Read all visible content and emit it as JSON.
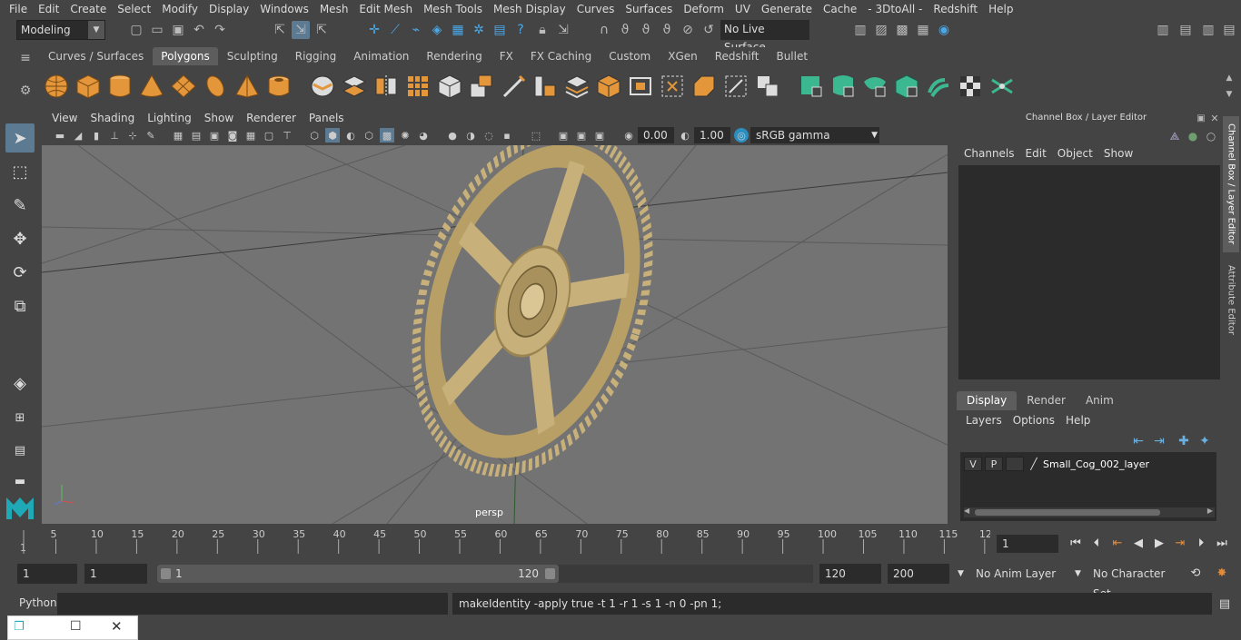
{
  "menubar": [
    "File",
    "Edit",
    "Create",
    "Select",
    "Modify",
    "Display",
    "Windows",
    "Mesh",
    "Edit Mesh",
    "Mesh Tools",
    "Mesh Display",
    "Curves",
    "Surfaces",
    "Deform",
    "UV",
    "Generate",
    "Cache",
    "- 3DtoAll -",
    "Redshift",
    "Help"
  ],
  "status": {
    "mode": "Modeling",
    "live_surface": "No Live Surface"
  },
  "shelf": {
    "tabs": [
      "Curves / Surfaces",
      "Polygons",
      "Sculpting",
      "Rigging",
      "Animation",
      "Rendering",
      "FX",
      "FX Caching",
      "Custom",
      "XGen",
      "Redshift",
      "Bullet"
    ],
    "active_tab": "Polygons"
  },
  "viewport": {
    "menu": [
      "View",
      "Shading",
      "Lighting",
      "Show",
      "Renderer",
      "Panels"
    ],
    "exposure": "0.00",
    "gamma": "1.00",
    "color_space": "sRGB gamma",
    "camera_label": "persp"
  },
  "channel_box": {
    "title": "Channel Box / Layer Editor",
    "menu": [
      "Channels",
      "Edit",
      "Object",
      "Show"
    ],
    "layer_tabs": [
      "Display",
      "Render",
      "Anim"
    ],
    "active_layer_tab": "Display",
    "layer_menu": [
      "Layers",
      "Options",
      "Help"
    ],
    "layer": {
      "v": "V",
      "p": "P",
      "name": "Small_Cog_002_layer"
    }
  },
  "side_tabs": [
    "Channel Box / Layer Editor",
    "Attribute Editor"
  ],
  "timeline": {
    "tick_labels": [
      "1",
      "5",
      "10",
      "15",
      "20",
      "25",
      "30",
      "35",
      "40",
      "45",
      "50",
      "55",
      "60",
      "65",
      "70",
      "75",
      "80",
      "85",
      "90",
      "95",
      "100",
      "105",
      "110",
      "115",
      "12"
    ],
    "current_frame": "1"
  },
  "range": {
    "start": "1",
    "playback_start": "1",
    "slider_start": "1",
    "slider_end": "120",
    "playback_end": "120",
    "end": "200",
    "anim_layer": "No Anim Layer",
    "character_set": "No Character Set"
  },
  "command": {
    "language": "Python",
    "output": "makeIdentity -apply true -t 1 -r 1 -s 1 -n 0 -pn 1;"
  },
  "colors": {
    "ui_bg": "#444444",
    "viewport_bg": "#737373",
    "selection_blue": "#5d7a93",
    "cog": "#c7b07a"
  }
}
